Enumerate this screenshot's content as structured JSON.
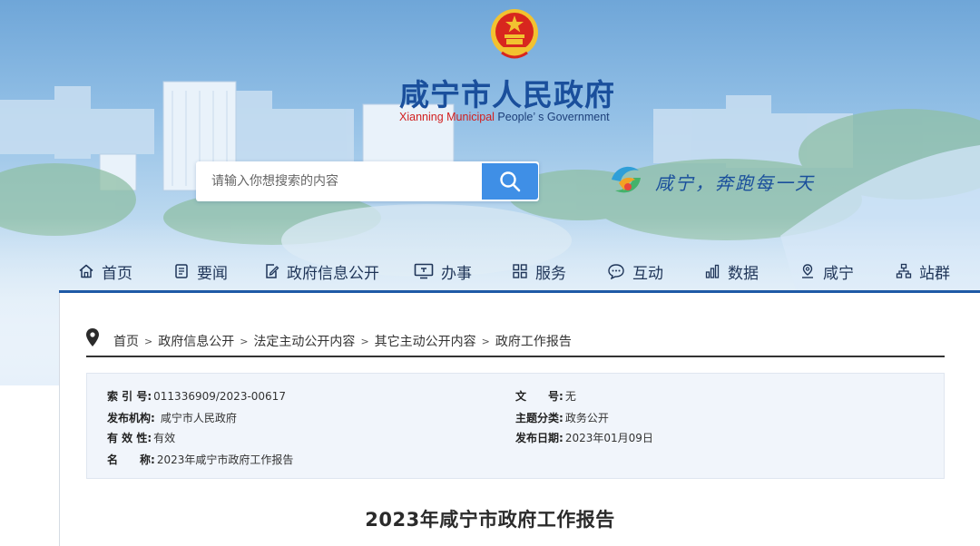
{
  "header": {
    "title": "咸宁市人民政府",
    "subtitle_red": "Xianning Municipal",
    "subtitle_rest": " People’ s Government",
    "slogan": "咸宁，奔跑每一天"
  },
  "search": {
    "placeholder": "请输入你想搜索的内容"
  },
  "nav": [
    {
      "label": "首页",
      "icon": "home-icon"
    },
    {
      "label": "要闻",
      "icon": "newspaper-icon"
    },
    {
      "label": "政府信息公开",
      "icon": "document-edit-icon"
    },
    {
      "label": "办事",
      "icon": "monitor-icon"
    },
    {
      "label": "服务",
      "icon": "grid-icon"
    },
    {
      "label": "互动",
      "icon": "chat-icon"
    },
    {
      "label": "数据",
      "icon": "bar-chart-icon"
    },
    {
      "label": "咸宁",
      "icon": "location-icon"
    },
    {
      "label": "站群",
      "icon": "sitemap-icon"
    }
  ],
  "breadcrumb": [
    "首页",
    "政府信息公开",
    "法定主动公开内容",
    "其它主动公开内容",
    "政府工作报告"
  ],
  "meta": {
    "index_label": "索 引 号:",
    "index_value": "011336909/2023-00617",
    "publisher_label": "发布机构:",
    "publisher_value": "咸宁市人民政府",
    "validity_label": "有 效 性:",
    "validity_value": "有效",
    "name_label": "名　　称:",
    "name_value": "2023年咸宁市政府工作报告",
    "docno_label": "文　　号:",
    "docno_value": "无",
    "category_label": "主题分类:",
    "category_value": "政务公开",
    "date_label": "发布日期:",
    "date_value": "2023年01月09日"
  },
  "document": {
    "title": "2023年咸宁市政府工作报告"
  },
  "colors": {
    "brand_blue": "#1a4f9c",
    "accent_blue": "#3f8fe6",
    "nav_divider": "#1f5aa6",
    "emblem_red": "#d8261e",
    "emblem_gold": "#f2c230"
  }
}
